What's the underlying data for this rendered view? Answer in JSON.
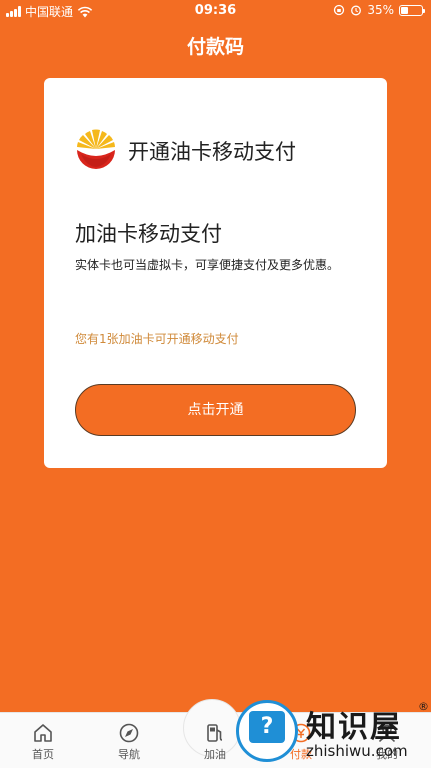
{
  "status_bar": {
    "carrier": "中国联通",
    "time": "09:36",
    "battery": "35%",
    "battery_level": 0.35
  },
  "header": {
    "title": "付款码"
  },
  "card": {
    "brand_title": "开通油卡移动支付",
    "heading": "加油卡移动支付",
    "description": "实体卡也可当虚拟卡，可享便捷支付及更多优惠。",
    "hint": "您有1张加油卡可开通移动支付",
    "open_button": "点击开通"
  },
  "tabs": [
    {
      "label": "首页",
      "icon": "home-icon"
    },
    {
      "label": "导航",
      "icon": "compass-icon"
    },
    {
      "label": "加油",
      "icon": "fuel-pump-icon"
    },
    {
      "label": "付款",
      "icon": "pay-icon"
    },
    {
      "label": "我的",
      "icon": "person-icon"
    }
  ],
  "watermark": {
    "text": "知识屋",
    "url": "zhishiwu.com",
    "registered": "®"
  },
  "colors": {
    "brand_orange": "#f36d23",
    "hint_text": "#d08a3a",
    "watermark_blue": "#1f8fd6"
  }
}
